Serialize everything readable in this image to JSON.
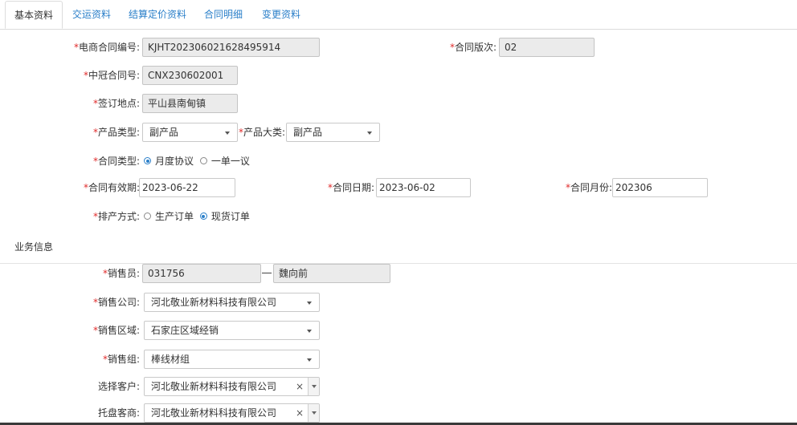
{
  "tabs": [
    "基本资料",
    "交运资料",
    "结算定价资料",
    "合同明细",
    "变更资料"
  ],
  "required_mark": "*",
  "fields": {
    "ec_contract_no": {
      "label": "电商合同编号:",
      "value": "KJHT202306021628495914"
    },
    "contract_version": {
      "label": "合同版次:",
      "value": "02"
    },
    "zg_contract_no": {
      "label": "中冠合同号:",
      "value": "CNX230602001"
    },
    "sign_place": {
      "label": "签订地点:",
      "value": "平山县南甸镇"
    },
    "product_type": {
      "label": "产品类型:",
      "value": "副产品"
    },
    "product_category": {
      "label": "产品大类:",
      "value": "副产品"
    },
    "contract_type": {
      "label": "合同类型:",
      "options": [
        "月度协议",
        "一单一议"
      ],
      "selected": "月度协议"
    },
    "valid_date": {
      "label": "合同有效期:",
      "value": "2023-06-22"
    },
    "contract_date": {
      "label": "合同日期:",
      "value": "2023-06-02"
    },
    "contract_month": {
      "label": "合同月份:",
      "value": "202306"
    },
    "schedule_mode": {
      "label": "排产方式:",
      "options": [
        "生产订单",
        "现货订单"
      ],
      "selected": "现货订单"
    }
  },
  "business": {
    "section_title": "业务信息",
    "salesman": {
      "label": "销售员:",
      "code": "031756",
      "name": "魏向前"
    },
    "company": {
      "label": "销售公司:",
      "value": "河北敬业新材料科技有限公司"
    },
    "region": {
      "label": "销售区域:",
      "value": "石家庄区域经销"
    },
    "group": {
      "label": "销售组:",
      "value": "棒线材组"
    },
    "customer": {
      "label": "选择客户:",
      "value": "河北敬业新材料科技有限公司"
    },
    "consignee": {
      "label": "托盘客商:",
      "value": "河北敬业新材料科技有限公司"
    }
  },
  "icons": {
    "clear": "×"
  },
  "colors": {
    "accent": "#2a7fc9",
    "required": "#e02b2b",
    "readonly_bg": "#ebebeb"
  }
}
